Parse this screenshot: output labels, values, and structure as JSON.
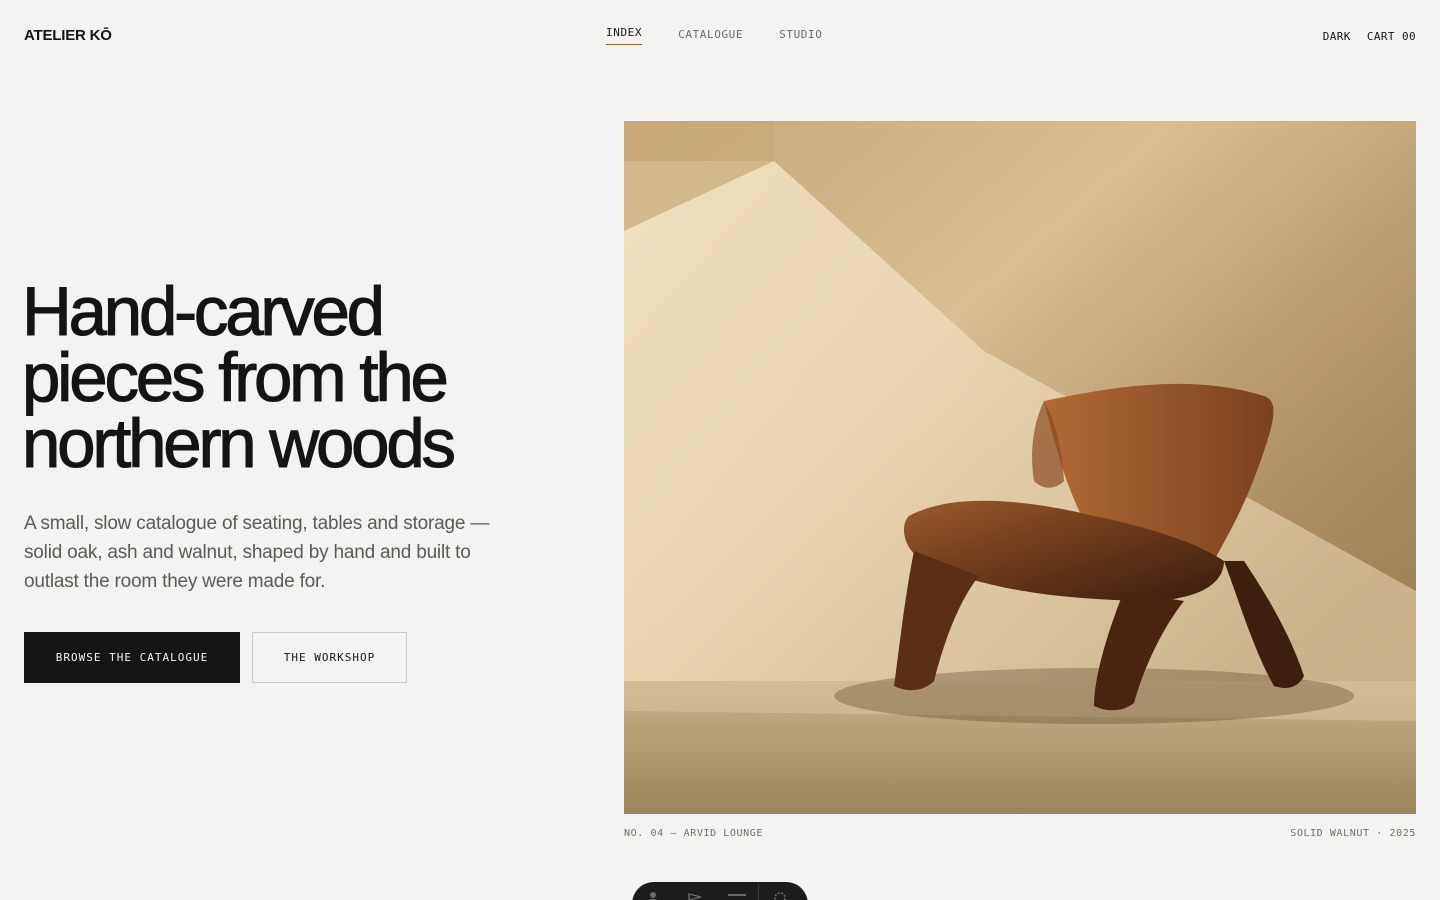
{
  "brand": {
    "logo": "ATELIER KŌ"
  },
  "nav": {
    "items": [
      {
        "label": "INDEX",
        "active": true
      },
      {
        "label": "CATALOGUE",
        "active": false
      },
      {
        "label": "STUDIO",
        "active": false
      }
    ]
  },
  "header_actions": {
    "theme_toggle": "DARK",
    "cart_label": "CART",
    "cart_count": "00"
  },
  "hero": {
    "title_lines": [
      "Hand-carved",
      "pieces from the",
      "northern woods"
    ],
    "subtitle": "A small, slow catalogue of seating, tables and storage — solid oak, ash and walnut, shaped by hand and built to outlast the room they were made for.",
    "primary_button": "BROWSE THE CATALOGUE",
    "secondary_button": "THE WORKSHOP"
  },
  "feature": {
    "caption_left": "NO. 04 — ARVID LOUNGE",
    "caption_right": "SOLID WALNUT · 2025"
  },
  "floating_toolbar": {
    "icons": [
      "person-icon",
      "pointer-icon",
      "menu-icon",
      "settings-icon"
    ]
  },
  "colors": {
    "background": "#f3f3f1",
    "ink": "#141414",
    "muted": "#5a5a57",
    "accent_underline": "#a0602f",
    "walnut": "#6b3a1d"
  }
}
